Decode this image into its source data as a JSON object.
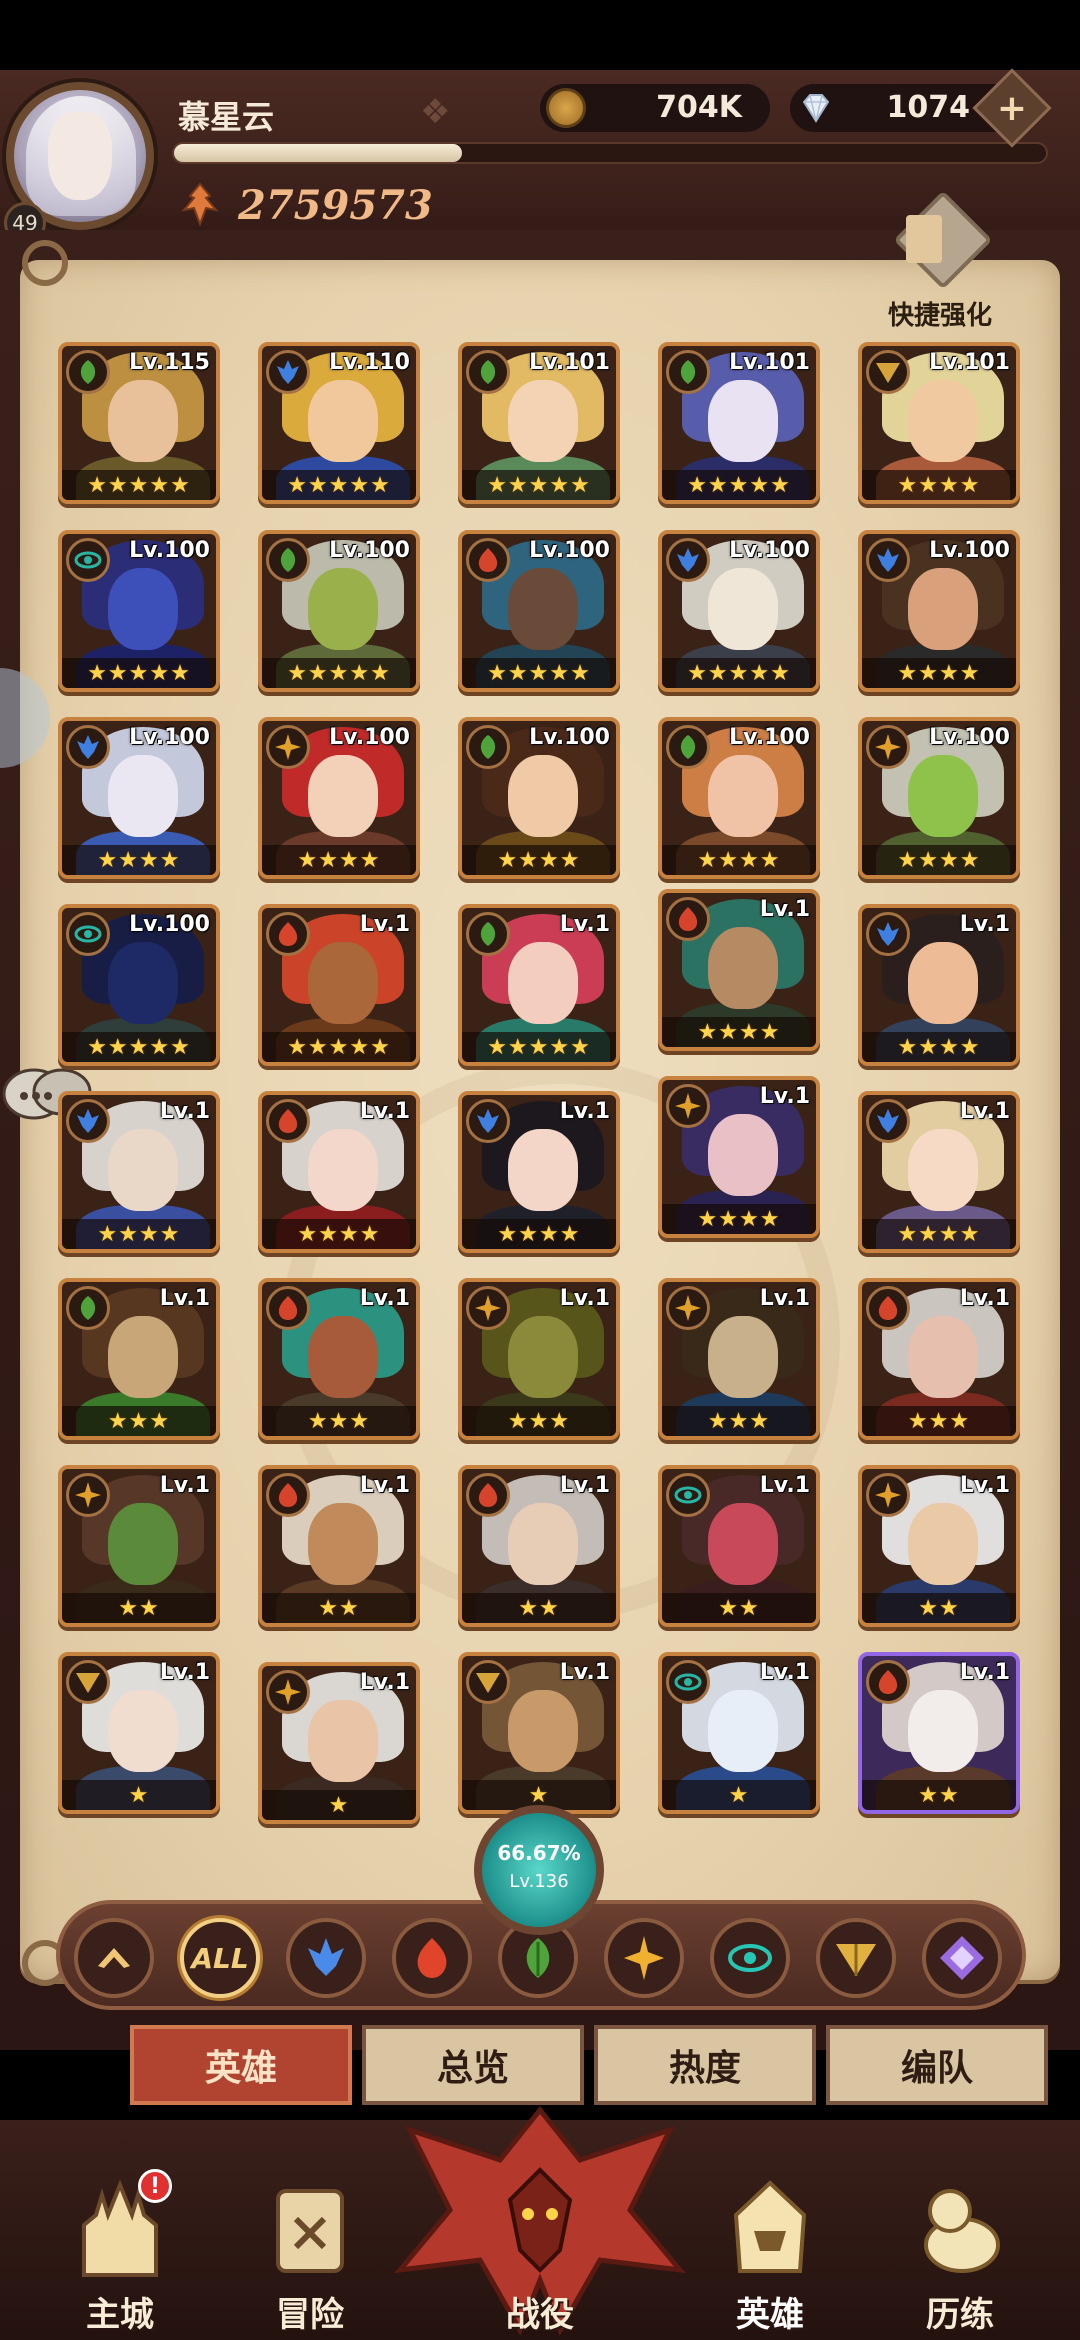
{
  "player": {
    "name": "慕星云",
    "level": "49",
    "power": "2759573",
    "xp_fraction": 0.33
  },
  "currency": {
    "gold": "704K",
    "gems": "1074",
    "add_label": "+"
  },
  "quick_upgrade_label": "快捷强化",
  "faction_colors": {
    "forest": "#4ea33a",
    "water": "#3f7fe0",
    "fire": "#d6452b",
    "light": "#e0a02a",
    "eye": "#27b5a4",
    "triangle": "#d7a43a",
    "void": "#8b5bd6"
  },
  "heroes": [
    {
      "level": "Lv.115",
      "faction": "forest",
      "stars": "★★★★★",
      "skin": "#e8c09a",
      "hair": "#c89a44",
      "body": "#6a5a2a"
    },
    {
      "level": "Lv.110",
      "faction": "water",
      "stars": "★★★★★",
      "skin": "#f1c79c",
      "hair": "#e9b640",
      "body": "#2e4aa0"
    },
    {
      "level": "Lv.101",
      "faction": "forest",
      "stars": "★★★★★",
      "skin": "#f4d2b4",
      "hair": "#f0c86a",
      "body": "#5a8a5a"
    },
    {
      "level": "Lv.101",
      "faction": "forest",
      "stars": "★★★★★",
      "skin": "#e8e2f2",
      "hair": "#5b63b8",
      "body": "#2b2d66"
    },
    {
      "level": "Lv.101",
      "faction": "triangle",
      "stars": "★★★★",
      "skin": "#f1c9a1",
      "hair": "#f1e3a4",
      "body": "#a85a3a"
    },
    {
      "level": "Lv.100",
      "faction": "eye",
      "stars": "★★★★★",
      "skin": "#3d4fb8",
      "hair": "#2b2f80",
      "body": "#1d2266"
    },
    {
      "level": "Lv.100",
      "faction": "forest",
      "stars": "★★★★★",
      "skin": "#9ab04a",
      "hair": "#c8c8b8",
      "body": "#5e6a3a"
    },
    {
      "level": "Lv.100",
      "faction": "fire",
      "stars": "★★★★★",
      "skin": "#6a4a38",
      "hair": "#2f6a88",
      "body": "#224455"
    },
    {
      "level": "Lv.100",
      "faction": "water",
      "stars": "★★★★★",
      "skin": "#f0e6d8",
      "hair": "#dedbd1",
      "body": "#3b3f4a"
    },
    {
      "level": "Lv.100",
      "faction": "water",
      "stars": "★★★★",
      "skin": "#d9a07c",
      "hair": "#4b3522",
      "body": "#2b2a2a"
    },
    {
      "level": "Lv.100",
      "faction": "water",
      "stars": "★★★★",
      "skin": "#eae6f2",
      "hair": "#cfd7ec",
      "body": "#3a5bb2"
    },
    {
      "level": "Lv.100",
      "faction": "light",
      "stars": "★★★★",
      "skin": "#f3d0b8",
      "hair": "#cc2b2b",
      "body": "#6b3a2a"
    },
    {
      "level": "Lv.100",
      "faction": "forest",
      "stars": "★★★★",
      "skin": "#f0c9a6",
      "hair": "#4d2a1a",
      "body": "#6b4a1a"
    },
    {
      "level": "Lv.100",
      "faction": "forest",
      "stars": "★★★★",
      "skin": "#f1c3a6",
      "hair": "#d9874a",
      "body": "#7a4a2a"
    },
    {
      "level": "Lv.100",
      "faction": "light",
      "stars": "★★★★",
      "skin": "#8fc24a",
      "hair": "#cfcfc0",
      "body": "#50602e"
    },
    {
      "level": "Lv.100",
      "faction": "eye",
      "stars": "★★★★★",
      "skin": "#1e2a66",
      "hair": "#151d4a",
      "body": "#2f3e3a"
    },
    {
      "level": "Lv.1",
      "faction": "fire",
      "stars": "★★★★★",
      "skin": "#a9673a",
      "hair": "#d8472b",
      "body": "#6a3a1a"
    },
    {
      "level": "Lv.1",
      "faction": "forest",
      "stars": "★★★★★",
      "skin": "#f3cdbd",
      "hair": "#d8405a",
      "body": "#2a7a6a"
    },
    {
      "level": "Lv.1",
      "faction": "fire",
      "stars": "★★★★",
      "skin": "#b68a62",
      "hair": "#2a7a6a",
      "body": "#2d3a2a"
    },
    {
      "level": "Lv.1",
      "faction": "water",
      "stars": "★★★★",
      "skin": "#edbb95",
      "hair": "#2a1f1f",
      "body": "#33415a"
    },
    {
      "level": "Lv.1",
      "faction": "water",
      "stars": "★★★★",
      "skin": "#e9d7c7",
      "hair": "#e6e2dc",
      "body": "#3a4fa0"
    },
    {
      "level": "Lv.1",
      "faction": "fire",
      "stars": "★★★★",
      "skin": "#f2d7ca",
      "hair": "#e6e2dc",
      "body": "#8a1e1e"
    },
    {
      "level": "Lv.1",
      "faction": "water",
      "stars": "★★★★",
      "skin": "#f3d6c8",
      "hair": "#1a1820",
      "body": "#20202a"
    },
    {
      "level": "Lv.1",
      "faction": "light",
      "stars": "★★★★",
      "skin": "#e9c0c6",
      "hair": "#3a2e6a",
      "body": "#2a2250"
    },
    {
      "level": "Lv.1",
      "faction": "water",
      "stars": "★★★★",
      "skin": "#f7dac6",
      "hair": "#f1dcae",
      "body": "#6a5a8a"
    },
    {
      "level": "Lv.1",
      "faction": "forest",
      "stars": "★★★",
      "skin": "#c8a678",
      "hair": "#5a3a22",
      "body": "#3a7a2a"
    },
    {
      "level": "Lv.1",
      "faction": "fire",
      "stars": "★★★",
      "skin": "#a85b3a",
      "hair": "#2b9c8a",
      "body": "#4a3a2a"
    },
    {
      "level": "Lv.1",
      "faction": "light",
      "stars": "★★★",
      "skin": "#8a8a3a",
      "hair": "#5a5a1a",
      "body": "#3a3a1a"
    },
    {
      "level": "Lv.1",
      "faction": "light",
      "stars": "★★★",
      "skin": "#c8b08a",
      "hair": "#3a2a1a",
      "body": "#1e3a5a"
    },
    {
      "level": "Lv.1",
      "faction": "fire",
      "stars": "★★★",
      "skin": "#e6bfae",
      "hair": "#d8d4ce",
      "body": "#7a2a1e"
    },
    {
      "level": "Lv.1",
      "faction": "light",
      "stars": "★★",
      "skin": "#5a8a3a",
      "hair": "#5a3a2a",
      "body": "#3a2a1a"
    },
    {
      "level": "Lv.1",
      "faction": "fire",
      "stars": "★★",
      "skin": "#c08a5a",
      "hair": "#e8dccb",
      "body": "#5a3a22"
    },
    {
      "level": "Lv.1",
      "faction": "fire",
      "stars": "★★",
      "skin": "#e8cdb6",
      "hair": "#cfcac6",
      "body": "#3b2d2a"
    },
    {
      "level": "Lv.1",
      "faction": "eye",
      "stars": "★★",
      "skin": "#c84a5a",
      "hair": "#4a2a2a",
      "body": "#3a1e1e"
    },
    {
      "level": "Lv.1",
      "faction": "light",
      "stars": "★★",
      "skin": "#e9c9a6",
      "hair": "#f0f0f0",
      "body": "#2a3a6a"
    },
    {
      "level": "Lv.1",
      "faction": "triangle",
      "stars": "★",
      "skin": "#f0ddd0",
      "hair": "#eeeeea",
      "body": "#3a4a6a"
    },
    {
      "level": "Lv.1",
      "faction": "light",
      "stars": "★",
      "skin": "#e9c4a6",
      "hair": "#e8e6e2",
      "body": "#3a2a22"
    },
    {
      "level": "Lv.1",
      "faction": "triangle",
      "stars": "★",
      "skin": "#c89a6a",
      "hair": "#7a5a3a",
      "body": "#4a3a2a"
    },
    {
      "level": "Lv.1",
      "faction": "eye",
      "stars": "★",
      "skin": "#e8eef8",
      "hair": "#e2e8f2",
      "body": "#2a4a8a"
    },
    {
      "level": "Lv.1",
      "faction": "fire",
      "stars": "★★",
      "skin": "#f2ecea",
      "hair": "#e0d8d0",
      "body": "#5a3a2a",
      "purple": true
    }
  ],
  "completion": {
    "percent": "66.67%",
    "level": "Lv.136"
  },
  "filters": [
    {
      "icon": "chevron-up-icon"
    },
    {
      "icon": "all-icon",
      "label": "ALL",
      "active": true
    },
    {
      "icon": "water-faction-icon"
    },
    {
      "icon": "fire-faction-icon"
    },
    {
      "icon": "forest-faction-icon"
    },
    {
      "icon": "light-faction-icon"
    },
    {
      "icon": "eye-faction-icon"
    },
    {
      "icon": "triangle-faction-icon"
    },
    {
      "icon": "void-faction-icon"
    }
  ],
  "tabs": [
    {
      "label": "英雄",
      "active": true
    },
    {
      "label": "总览"
    },
    {
      "label": "热度"
    },
    {
      "label": "编队"
    }
  ],
  "nav": [
    {
      "label": "主城",
      "alert": "!"
    },
    {
      "label": "冒险"
    },
    {
      "label": "战役"
    },
    {
      "label": "英雄",
      "active": true
    },
    {
      "label": "历练"
    }
  ]
}
